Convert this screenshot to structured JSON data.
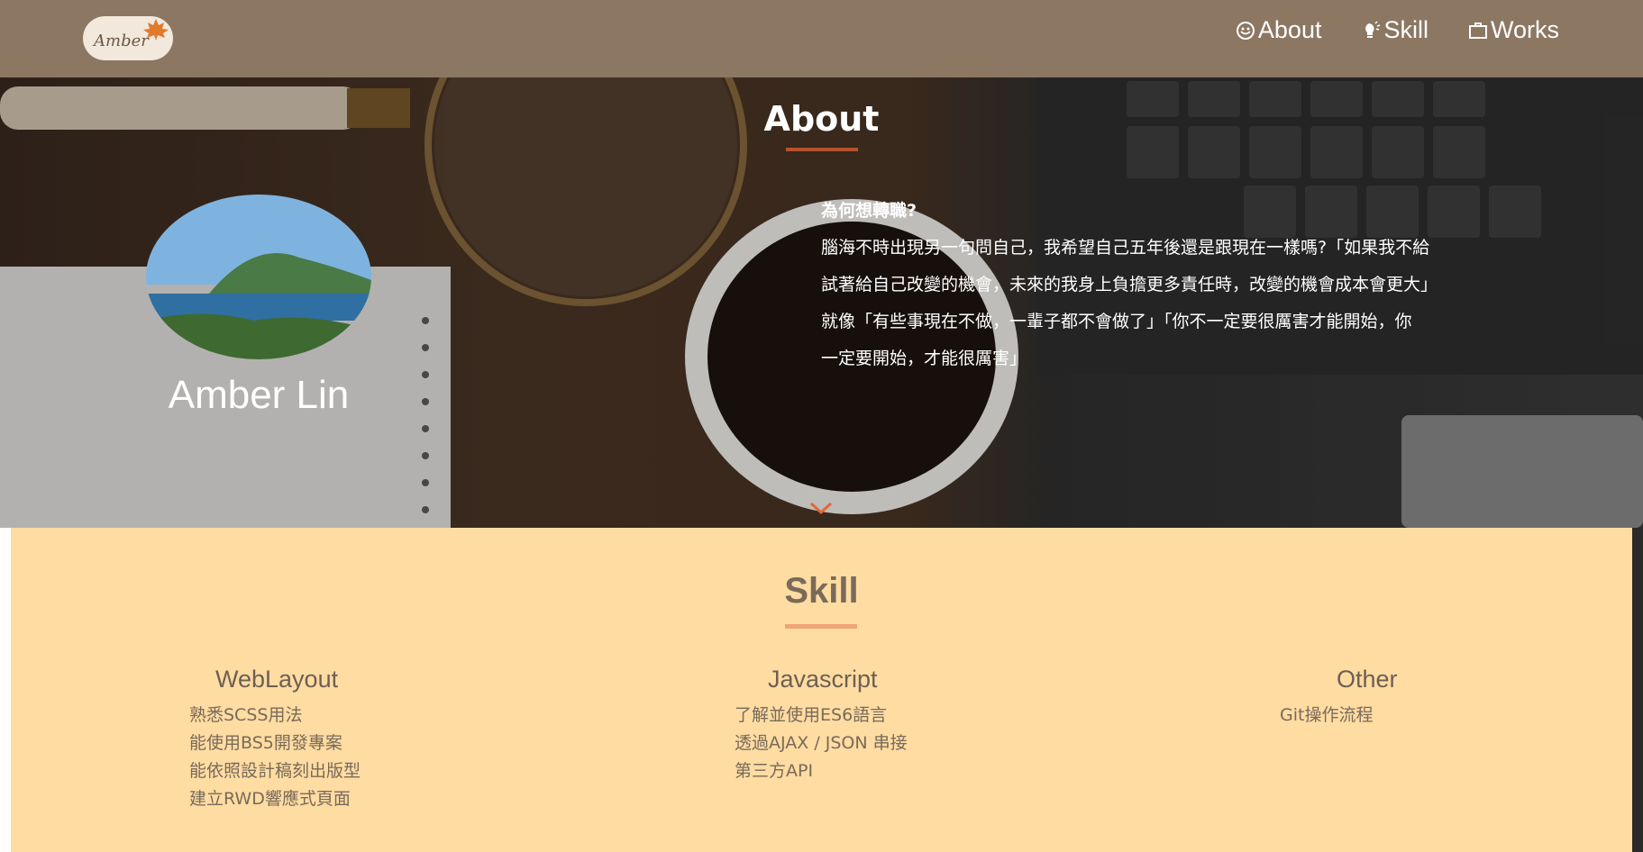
{
  "nav": {
    "logo_text": "Amber",
    "links": [
      {
        "label": "About",
        "icon": "smiley-icon"
      },
      {
        "label": "Skill",
        "icon": "lightbulb-icon"
      },
      {
        "label": "Works",
        "icon": "briefcase-icon"
      }
    ]
  },
  "about": {
    "title": "About",
    "name": "Amber Lin",
    "heading": "為何想轉職?",
    "lines": [
      "腦海不時出現另一句問自己，我希望自己五年後還是跟現在一樣嗎?「如果我不給",
      "試著給自己改變的機會，未來的我身上負擔更多責任時，改變的機會成本會更大」",
      "就像「有些事現在不做，一輩子都不會做了」「你不一定要很厲害才能開始，你",
      "一定要開始，才能很厲害」"
    ]
  },
  "skill": {
    "title": "Skill",
    "columns": [
      {
        "title": "WebLayout",
        "items": [
          "熟悉SCSS用法",
          "能使用BS5開發專案",
          "能依照設計稿刻出版型",
          "建立RWD響應式頁面"
        ]
      },
      {
        "title": "Javascript",
        "items": [
          "了解並使用ES6語言",
          "透過AJAX / JSON 串接",
          "第三方API"
        ]
      },
      {
        "title": "Other",
        "items": [
          "Git操作流程"
        ]
      }
    ]
  },
  "colors": {
    "navbar": "#8c7763",
    "skill_bg": "#fedca2",
    "accent": "#f0a47a"
  }
}
